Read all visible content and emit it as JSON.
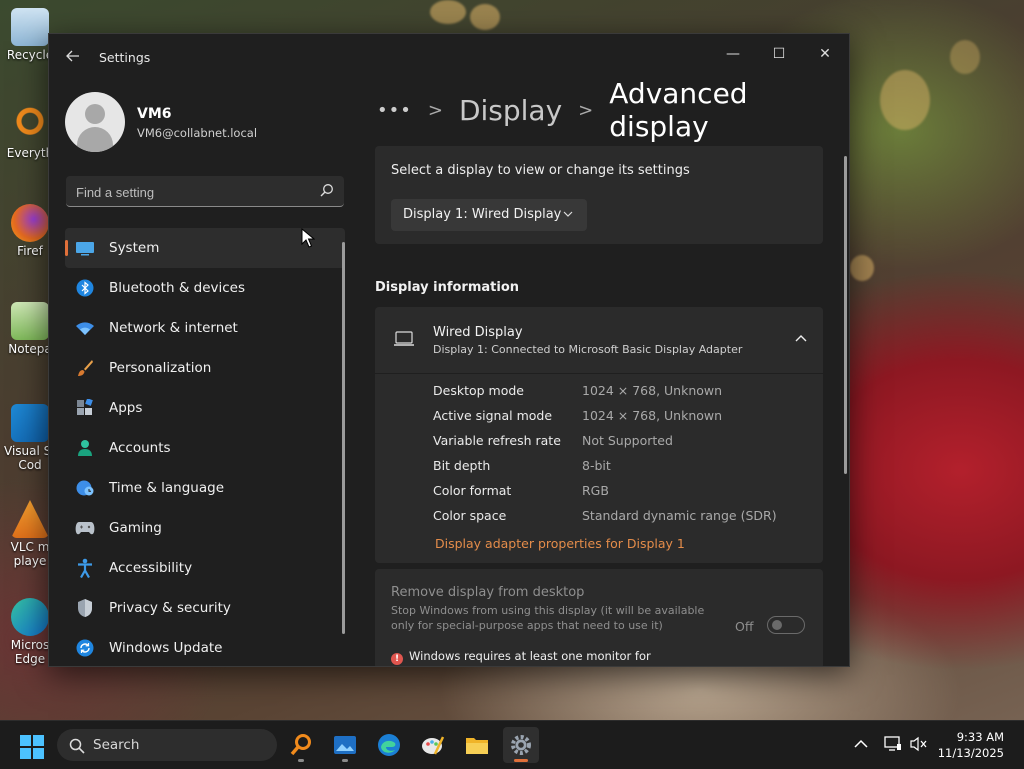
{
  "desktop": {
    "icons": [
      {
        "label": "Recycle",
        "icon": "recycle-bin-icon"
      },
      {
        "label": "Everyth",
        "icon": "everything-search-icon"
      },
      {
        "label": "Firef",
        "icon": "firefox-icon"
      },
      {
        "label": "Notepa",
        "icon": "notepad-icon"
      },
      {
        "label": "Visual St Cod",
        "icon": "vscode-icon"
      },
      {
        "label": "VLC m playe",
        "icon": "vlc-icon"
      },
      {
        "label": "Micros Edge",
        "icon": "edge-icon"
      }
    ]
  },
  "window": {
    "app_title": "Settings",
    "controls": {
      "minimize": "—",
      "maximize": "☐",
      "close": "✕"
    }
  },
  "user": {
    "name": "VM6",
    "email": "VM6@collabnet.local"
  },
  "search": {
    "placeholder": "Find a setting"
  },
  "nav": {
    "items": [
      {
        "label": "System",
        "icon": "system-icon",
        "selected": true
      },
      {
        "label": "Bluetooth & devices",
        "icon": "bluetooth-icon"
      },
      {
        "label": "Network & internet",
        "icon": "network-icon"
      },
      {
        "label": "Personalization",
        "icon": "brush-icon"
      },
      {
        "label": "Apps",
        "icon": "apps-icon"
      },
      {
        "label": "Accounts",
        "icon": "accounts-icon"
      },
      {
        "label": "Time & language",
        "icon": "globe-clock-icon"
      },
      {
        "label": "Gaming",
        "icon": "gamepad-icon"
      },
      {
        "label": "Accessibility",
        "icon": "accessibility-icon"
      },
      {
        "label": "Privacy & security",
        "icon": "shield-icon"
      },
      {
        "label": "Windows Update",
        "icon": "update-icon"
      }
    ]
  },
  "breadcrumb": {
    "more": "•••",
    "sep": ">",
    "parent": "Display",
    "current": "Advanced display"
  },
  "display_select": {
    "label": "Select a display to view or change its settings",
    "selected": "Display 1: Wired Display"
  },
  "display_info": {
    "section_title": "Display information",
    "title": "Wired Display",
    "subtitle": "Display 1: Connected to Microsoft Basic Display Adapter",
    "rows": [
      {
        "key": "Desktop mode",
        "value": "1024 × 768, Unknown"
      },
      {
        "key": "Active signal mode",
        "value": "1024 × 768, Unknown"
      },
      {
        "key": "Variable refresh rate",
        "value": "Not Supported"
      },
      {
        "key": "Bit depth",
        "value": "8-bit"
      },
      {
        "key": "Color format",
        "value": "RGB"
      },
      {
        "key": "Color space",
        "value": "Standard dynamic range (SDR)"
      }
    ],
    "adapter_link": "Display adapter properties for Display 1"
  },
  "remove_display": {
    "title": "Remove display from desktop",
    "description": "Stop Windows from using this display (it will be available only for special-purpose apps that need to use it)",
    "toggle_label": "Off",
    "toggle_on": false,
    "warning": "Windows requires at least one monitor for displaying the desktop."
  },
  "taskbar": {
    "search_label": "Search",
    "apps": [
      {
        "name": "everything-search-icon",
        "active": false
      },
      {
        "name": "image-viewer-icon",
        "active": false
      },
      {
        "name": "edge-icon",
        "active": false
      },
      {
        "name": "paint-icon",
        "active": false
      },
      {
        "name": "file-explorer-icon",
        "active": false
      },
      {
        "name": "settings-gear-icon",
        "active": true
      }
    ],
    "time": "9:33 AM",
    "date": "11/13/2025"
  },
  "colors": {
    "accent": "#e0703a",
    "link": "#e48c4a",
    "window_bg": "#1f1f1f",
    "card_bg": "#2b2b2b",
    "taskbar_bg": "#1c1c1c"
  }
}
